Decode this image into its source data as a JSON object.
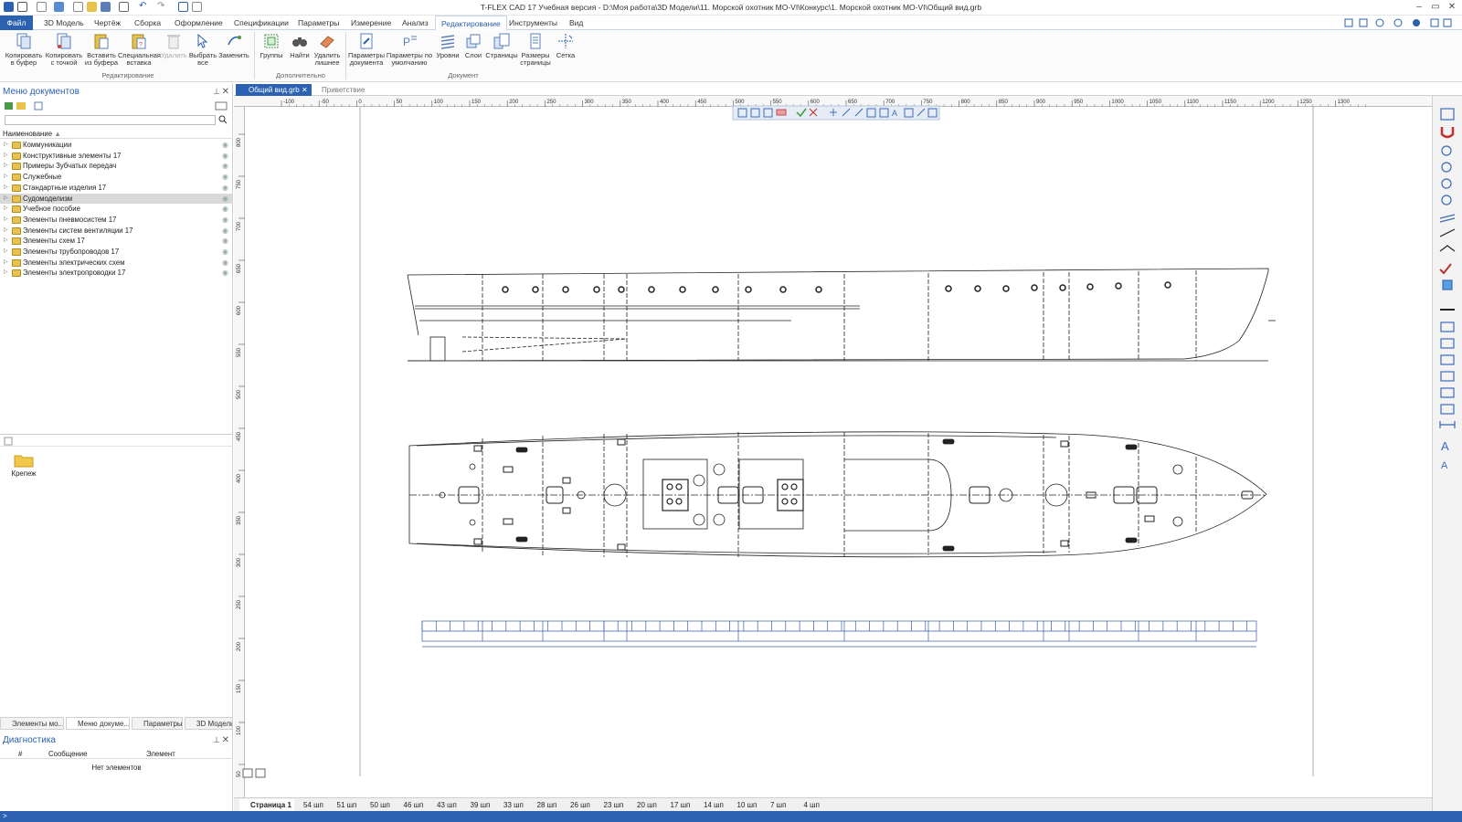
{
  "window": {
    "title": "T-FLEX CAD 17 Учебная версия - D:\\Моя работа\\3D Модели\\11. Морской охотник МО-VI\\Конкурс\\1. Морской охотник МО-VI\\Общий вид.grb"
  },
  "ribbon_tabs": [
    "Файл",
    "3D Модель",
    "Чертёж",
    "Сборка",
    "Оформление",
    "Спецификации",
    "Параметры",
    "Измерение",
    "Анализ",
    "Редактирование",
    "Инструменты",
    "Вид"
  ],
  "ribbon": {
    "buttons": [
      {
        "label1": "Копировать",
        "label2": "в буфер"
      },
      {
        "label1": "Копировать",
        "label2": "с точкой"
      },
      {
        "label1": "Вставить",
        "label2": "из буфера"
      },
      {
        "label1": "Специальная",
        "label2": "вставка"
      },
      {
        "label1": "Удалить",
        "label2": ""
      },
      {
        "label1": "Выбрать",
        "label2": "все"
      },
      {
        "label1": "Заменить",
        "label2": ""
      },
      {
        "label1": "Группы",
        "label2": ""
      },
      {
        "label1": "Найти",
        "label2": ""
      },
      {
        "label1": "Удалить",
        "label2": "лишнее"
      },
      {
        "label1": "Параметры",
        "label2": "документа"
      },
      {
        "label1": "Параметры по",
        "label2": "умолчанию"
      },
      {
        "label1": "Уровни",
        "label2": ""
      },
      {
        "label1": "Слои",
        "label2": ""
      },
      {
        "label1": "Страницы",
        "label2": ""
      },
      {
        "label1": "Размеры",
        "label2": "страницы"
      },
      {
        "label1": "Сетка",
        "label2": ""
      }
    ],
    "groups": [
      "Редактирование",
      "Дополнительно",
      "Документ"
    ]
  },
  "doc_menu": {
    "title": "Меню документов",
    "column": "Наименование",
    "items": [
      "Коммуникации",
      "Конструктивные элементы 17",
      "Примеры Зубчатых передач",
      "Служебные",
      "Стандартные изделия 17",
      "Судомоделизм",
      "Учебное пособие",
      "Элементы пневмосистем 17",
      "Элементы систем вентиляции 17",
      "Элементы схем 17",
      "Элементы трубопроводов 17",
      "Элементы электрических схем",
      "Элементы электропроводки 17"
    ],
    "selected_index": 5,
    "folder_preview": "Крепеж"
  },
  "bottom_tabs": [
    "Элементы мо...",
    "Меню докуме...",
    "Параметры",
    "3D Модель"
  ],
  "diagnostics": {
    "title": "Диагностика",
    "columns": [
      "#",
      "Сообщение",
      "Элемент"
    ],
    "empty": "Нет элементов"
  },
  "doc_tabs": [
    "Общий вид.grb",
    "Приветствие"
  ],
  "ruler": {
    "h_labels": [
      "-100",
      "-50",
      "0",
      "50",
      "100",
      "150",
      "200",
      "250",
      "300",
      "350",
      "400",
      "450",
      "500",
      "550",
      "600",
      "650",
      "700",
      "750",
      "800",
      "850",
      "900",
      "950",
      "1000",
      "1050",
      "1100",
      "1150",
      "1200",
      "1250",
      "1300"
    ],
    "v_labels": [
      "800",
      "750",
      "700",
      "650",
      "600",
      "550",
      "500",
      "450",
      "400",
      "350",
      "300",
      "250",
      "200",
      "150",
      "100",
      "50"
    ]
  },
  "page_tabs": [
    "Страница 1",
    "54 шп",
    "51 шп",
    "50 шп",
    "46 шп",
    "43 шп",
    "39 шп",
    "33 шп",
    "28 шп",
    "26 шп",
    "23 шп",
    "20 шп",
    "17 шп",
    "14 шп",
    "10 шп",
    "7 шп",
    "4 шп"
  ],
  "status_text": ">"
}
